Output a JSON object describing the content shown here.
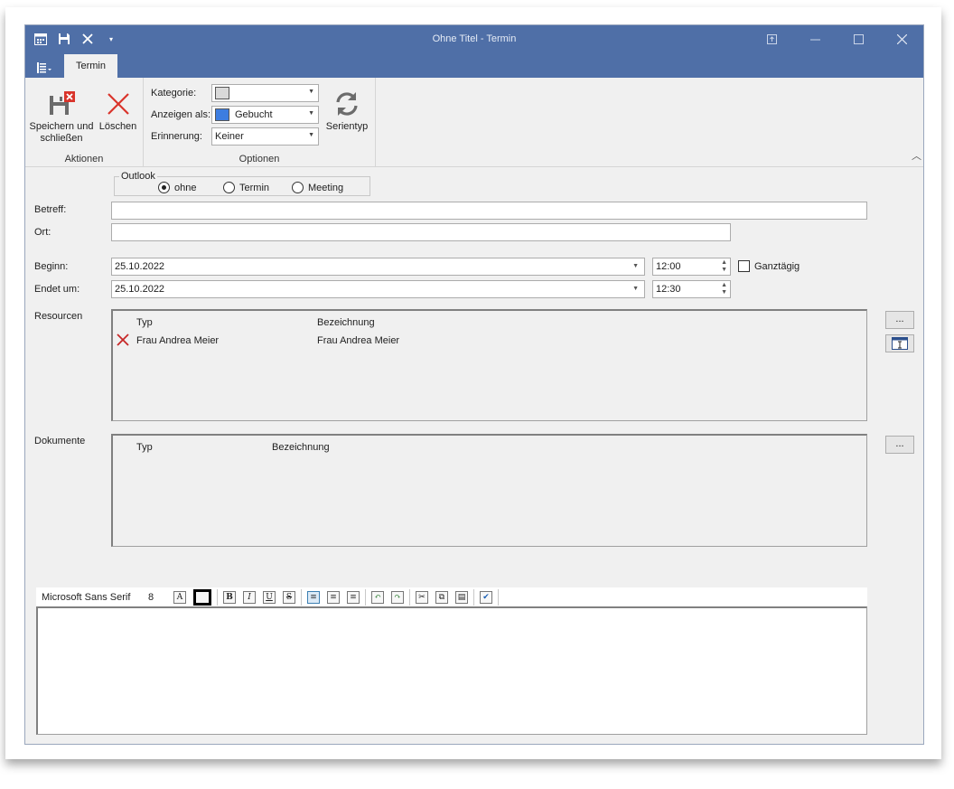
{
  "window": {
    "title": "Ohne Titel - Termin"
  },
  "ribbon": {
    "tab_label": "Termin",
    "actions": {
      "save_close_label_line1": "Speichern und",
      "save_close_label_line2": "schließen",
      "delete_label": "Löschen",
      "group_label": "Aktionen"
    },
    "options": {
      "category_label": "Kategorie:",
      "category_value": "",
      "category_color": "#d9d9d9",
      "show_as_label": "Anzeigen als:",
      "show_as_value": "Gebucht",
      "show_as_color": "#3d7de0",
      "reminder_label": "Erinnerung:",
      "reminder_value": "Keiner",
      "series_label": "Serientyp",
      "group_label": "Optionen"
    }
  },
  "form": {
    "outlook_legend": "Outlook",
    "radios": [
      {
        "label": "ohne",
        "selected": true
      },
      {
        "label": "Termin",
        "selected": false
      },
      {
        "label": "Meeting",
        "selected": false
      }
    ],
    "subject_label": "Betreff:",
    "subject_value": "",
    "location_label": "Ort:",
    "location_value": "",
    "start_label": "Beginn:",
    "start_date": "25.10.2022",
    "start_time": "12:00",
    "allday_label": "Ganztägig",
    "allday_checked": false,
    "end_label": "Endet um:",
    "end_date": "25.10.2022",
    "end_time": "12:30",
    "resources_label": "Resourcen",
    "resources_columns": [
      "Typ",
      "Bezeichnung"
    ],
    "resources_rows": [
      {
        "type": "Frau Andrea Meier",
        "name": "Frau Andrea Meier"
      }
    ],
    "documents_label": "Dokumente",
    "documents_columns": [
      "Typ",
      "Bezeichnung"
    ],
    "ellipsis_label": "..."
  },
  "editor": {
    "font_name": "Microsoft Sans Serif",
    "font_size": "8"
  }
}
